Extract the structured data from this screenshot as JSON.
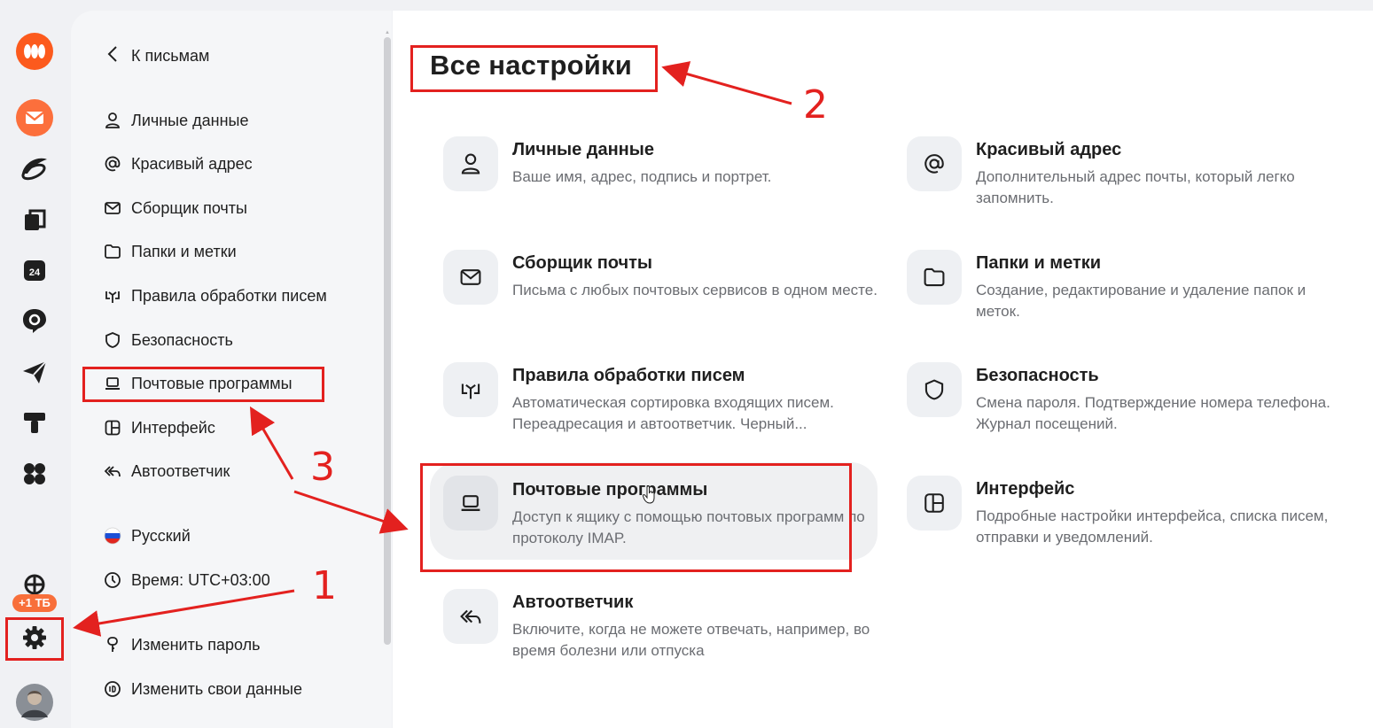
{
  "colors": {
    "accent": "#fc3f1d",
    "annotation": "#e3211f"
  },
  "rail": {
    "icons": [
      "yandex-360-logo-icon",
      "mail-icon",
      "disk-icon",
      "docs-icon",
      "calendar-icon",
      "messenger-icon",
      "telemost-icon",
      "tracker-icon",
      "all-services-icon",
      "storage-icon",
      "settings-icon",
      "avatar"
    ],
    "calendar_day": "24",
    "storage_badge": "+1 ТБ"
  },
  "sidebar": {
    "back_label": "К письмам",
    "items": [
      {
        "label": "Личные данные",
        "icon": "person-icon"
      },
      {
        "label": "Красивый адрес",
        "icon": "at-icon"
      },
      {
        "label": "Сборщик почты",
        "icon": "envelope-icon"
      },
      {
        "label": "Папки и метки",
        "icon": "folder-icon"
      },
      {
        "label": "Правила обработки писем",
        "icon": "rules-icon"
      },
      {
        "label": "Безопасность",
        "icon": "shield-icon"
      },
      {
        "label": "Почтовые программы",
        "icon": "laptop-icon"
      },
      {
        "label": "Интерфейс",
        "icon": "layout-icon"
      },
      {
        "label": "Автоответчик",
        "icon": "reply-all-icon"
      }
    ],
    "language": "Русский",
    "time": "Время: UTC+03:00",
    "change_password": "Изменить пароль",
    "change_data": "Изменить свои данные"
  },
  "main": {
    "title": "Все настройки",
    "cards": [
      {
        "title": "Личные данные",
        "desc": "Ваше имя, адрес, подпись и портрет.",
        "icon": "person-icon"
      },
      {
        "title": "Красивый адрес",
        "desc": "Дополнительный адрес почты, который легко запомнить.",
        "icon": "at-icon"
      },
      {
        "title": "Сборщик почты",
        "desc": "Письма с любых почтовых сервисов в одном месте.",
        "icon": "envelope-icon"
      },
      {
        "title": "Папки и метки",
        "desc": "Создание, редактирование и удаление папок и меток.",
        "icon": "folder-icon"
      },
      {
        "title": "Правила обработки писем",
        "desc": "Автоматическая сортировка входящих писем. Переадресация и автоответчик. Черный...",
        "icon": "rules-icon"
      },
      {
        "title": "Безопасность",
        "desc": "Смена пароля. Подтверждение номера телефона. Журнал посещений.",
        "icon": "shield-icon"
      },
      {
        "title": "Почтовые программы",
        "desc": "Доступ к ящику с помощью почтовых программ по протоколу IMAP.",
        "icon": "laptop-icon"
      },
      {
        "title": "Интерфейс",
        "desc": "Подробные настройки интерфейса, списка писем, отправки и уведомлений.",
        "icon": "layout-icon"
      },
      {
        "title": "Автоответчик",
        "desc": "Включите, когда не можете отвечать, например, во время болезни или отпуска",
        "icon": "reply-all-icon"
      }
    ]
  },
  "annotations": {
    "n1": "1",
    "n2": "2",
    "n3": "3"
  }
}
